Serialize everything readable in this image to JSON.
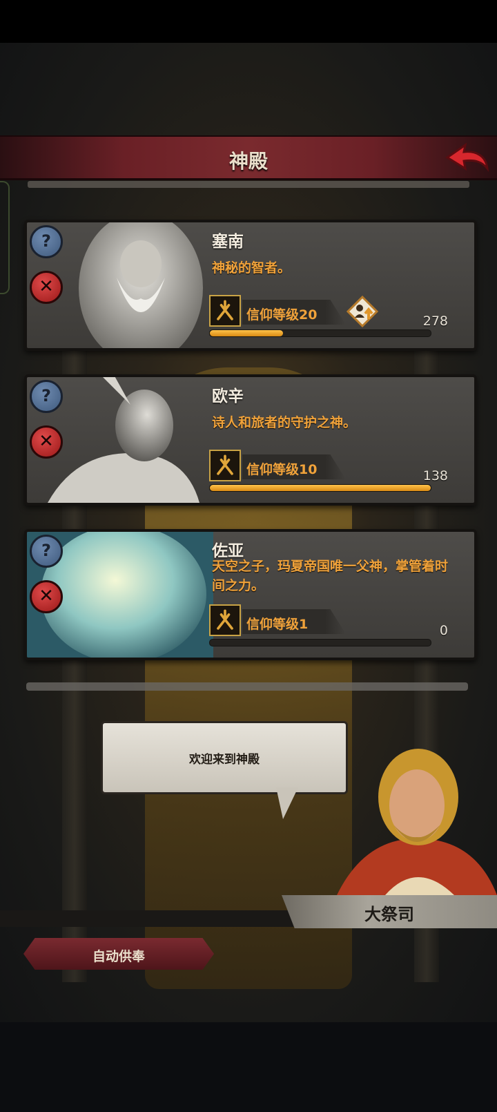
{
  "header": {
    "title": "神殿"
  },
  "gods": [
    {
      "name": "塞南",
      "description": "神秘的智者。",
      "faith_label": "信仰等级",
      "faith_level": "20",
      "points": "278",
      "progress": 0.33,
      "can_promote": true
    },
    {
      "name": "欧辛",
      "description": "诗人和旅者的守护之神。",
      "faith_label": "信仰等级",
      "faith_level": "10",
      "points": "138",
      "progress": 1.0,
      "can_promote": false
    },
    {
      "name": "佐亚",
      "description": "天空之子，玛夏帝国唯一父神，掌管着时间之力。",
      "faith_label": "信仰等级",
      "faith_level": "1",
      "points": "0",
      "progress": 0.0,
      "can_promote": false
    }
  ],
  "dialog": {
    "text": "欢迎来到神殿"
  },
  "npc": {
    "name": "大祭司"
  },
  "auto_button": {
    "label": "自动供奉"
  },
  "colors": {
    "accent_orange": "#f0a23a",
    "header_red": "#7a2a2e",
    "help_blue": "#4f6b90",
    "remove_red": "#c02a2a"
  },
  "icons": {
    "help": "question-icon",
    "remove": "close-icon",
    "back": "back-arrow-icon",
    "faith": "faith-rune-icon",
    "promote": "level-up-icon"
  }
}
